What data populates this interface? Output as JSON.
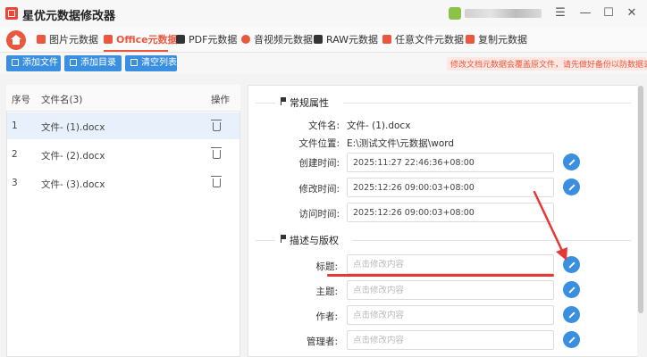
{
  "app": {
    "title": "星优元数据修改器"
  },
  "window": {
    "icons": [
      "menu-icon",
      "minimize-icon",
      "maximize-icon",
      "close-icon"
    ]
  },
  "tabs": [
    {
      "label": "图片元数据",
      "active": false
    },
    {
      "label": "Office元数据",
      "active": true
    },
    {
      "label": "PDF元数据",
      "active": false
    },
    {
      "label": "音视频元数据",
      "active": false
    },
    {
      "label": "RAW元数据",
      "active": false
    },
    {
      "label": "任意文件元数据",
      "active": false
    },
    {
      "label": "复制元数据",
      "active": false
    }
  ],
  "toolbar": {
    "add_file": "添加文件",
    "add_folder": "添加目录",
    "clear_list": "清空列表",
    "warning": "修改文档元数据会覆盖原文件，请先做好备份以防数据丢失！"
  },
  "file_list": {
    "headers": {
      "index": "序号",
      "name": "文件名(3)",
      "action": "操作"
    },
    "rows": [
      {
        "index": "1",
        "name": "文件- (1).docx",
        "selected": true
      },
      {
        "index": "2",
        "name": "文件- (2).docx",
        "selected": false
      },
      {
        "index": "3",
        "name": "文件- (3).docx",
        "selected": false
      }
    ]
  },
  "details": {
    "common_section": "常规属性",
    "file_name_label": "文件名:",
    "file_name": "文件- (1).docx",
    "file_path_label": "文件位置:",
    "file_path": "E:\\测试文件\\元数据\\word",
    "created_label": "创建时间:",
    "created": "2025:11:27 22:46:36+08:00",
    "modified_label": "修改时间:",
    "modified": "2025:12:26 09:00:03+08:00",
    "accessed_label": "访问时间:",
    "accessed": "2025:12:26 09:00:03+08:00",
    "desc_section": "描述与版权",
    "title_label": "标题:",
    "subject_label": "主题:",
    "author_label": "作者:",
    "manager_label": "管理者:",
    "placeholder": "点击修改内容"
  },
  "colors": {
    "accent": "#e9573f",
    "primary": "#3b8fe0",
    "annotation": "#e53935"
  }
}
